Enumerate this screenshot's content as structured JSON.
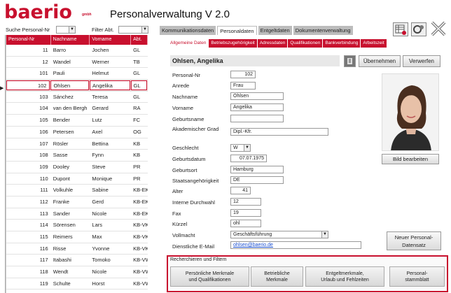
{
  "header": {
    "logo_text": "baerio",
    "logo_sub": "gmbh",
    "title": "Personalverwaltung V 2.0"
  },
  "filters": {
    "search_label": "Suche Personal-Nr",
    "filter_label": "Filter Abt."
  },
  "list": {
    "columns": [
      "Personal-Nr",
      "Nachname",
      "Vorname",
      "Abt."
    ],
    "rows": [
      [
        "11",
        "Barro",
        "Jochen",
        "GL"
      ],
      [
        "12",
        "Wandel",
        "Werner",
        "TB"
      ],
      [
        "101",
        "Pauli",
        "Helmut",
        "GL"
      ],
      [
        "102",
        "Ohlsen",
        "Angelika",
        "GL"
      ],
      [
        "103",
        "Sánchez",
        "Teresa",
        "GL"
      ],
      [
        "104",
        "van den Bergh",
        "Gerard",
        "RA"
      ],
      [
        "105",
        "Bender",
        "Lutz",
        "FC"
      ],
      [
        "106",
        "Petersen",
        "Axel",
        "OG"
      ],
      [
        "107",
        "Rösler",
        "Bettina",
        "KB"
      ],
      [
        "108",
        "Sasse",
        "Fynn",
        "KB"
      ],
      [
        "109",
        "Dooley",
        "Steve",
        "PR"
      ],
      [
        "110",
        "Dupont",
        "Monique",
        "PR"
      ],
      [
        "111",
        "Volkuhle",
        "Sabine",
        "KB-EK"
      ],
      [
        "112",
        "Franke",
        "Gerd",
        "KB-EK"
      ],
      [
        "113",
        "Sander",
        "Nicole",
        "KB-EK"
      ],
      [
        "114",
        "Sörensen",
        "Lars",
        "KB-VK"
      ],
      [
        "115",
        "Reimers",
        "Max",
        "KB-VK"
      ],
      [
        "116",
        "Risse",
        "Yvonne",
        "KB-VK"
      ],
      [
        "117",
        "Itabashi",
        "Tomoko",
        "KB-VW"
      ],
      [
        "118",
        "Wendt",
        "Nicole",
        "KB-VW"
      ],
      [
        "119",
        "Schulte",
        "Horst",
        "KB-VW"
      ]
    ],
    "selected_index": 3
  },
  "tabs": [
    "Kommunikationsdaten",
    "Personaldaten",
    "Entgeltdaten",
    "Dokumentenverwaltung"
  ],
  "subtabs": [
    "Allgemeine Daten",
    "Betriebszugehörigkeit",
    "Adressdaten",
    "Qualifikationen",
    "Bankverbindung",
    "Arbeitszeit"
  ],
  "employee": {
    "name": "Ohlsen, Angelika",
    "fields": {
      "personal_nr": {
        "label": "Personal-Nr",
        "value": "102"
      },
      "anrede": {
        "label": "Anrede",
        "value": "Frau"
      },
      "nachname": {
        "label": "Nachname",
        "value": "Ohlsen"
      },
      "vorname": {
        "label": "Vorname",
        "value": "Angelika"
      },
      "geburtsname": {
        "label": "Geburtsname",
        "value": ""
      },
      "akad_grad": {
        "label": "Akademischer Grad",
        "value": "Dipl.-Kfr."
      },
      "geschlecht": {
        "label": "Geschlecht",
        "value": "W"
      },
      "geburtsdatum": {
        "label": "Geburtsdatum",
        "value": "07.07.1975"
      },
      "geburtsort": {
        "label": "Geburtsort",
        "value": "Hamburg"
      },
      "staatsang": {
        "label": "Staatsangehörigkeit",
        "value": "DE"
      },
      "alter": {
        "label": "Alter",
        "value": "41"
      },
      "interne_durchwahl": {
        "label": "Interne Durchwahl",
        "value": "12"
      },
      "fax": {
        "label": "Fax",
        "value": "19"
      },
      "kuerzel": {
        "label": "Kürzel",
        "value": "ohl"
      },
      "vollmacht": {
        "label": "Vollmacht",
        "value": "Geschäftsführung"
      },
      "email": {
        "label": "Dienstliche E-Mail",
        "value": "ohlsen@baerio.de"
      }
    }
  },
  "buttons": {
    "uebernehmen": "Übernehmen",
    "verwerfen": "Verwerfen",
    "bild_bearbeiten": "Bild bearbeiten",
    "neuer_datensatz_1": "Neuer Personal-",
    "neuer_datensatz_2": "Datensatz"
  },
  "search": {
    "title": "Recherchieren und Filtern",
    "b1_l1": "Persönliche Merkmale",
    "b1_l2": "und Qualifikationen",
    "b2_l1": "Betriebliche",
    "b2_l2": "Merkmale",
    "b3_l1": "Entgeltmerkmale,",
    "b3_l2": "Urlaub und Fehlzeiten",
    "b4_l1": "Personal-",
    "b4_l2": "stammblatt"
  },
  "colors": {
    "accent": "#c8102e"
  }
}
